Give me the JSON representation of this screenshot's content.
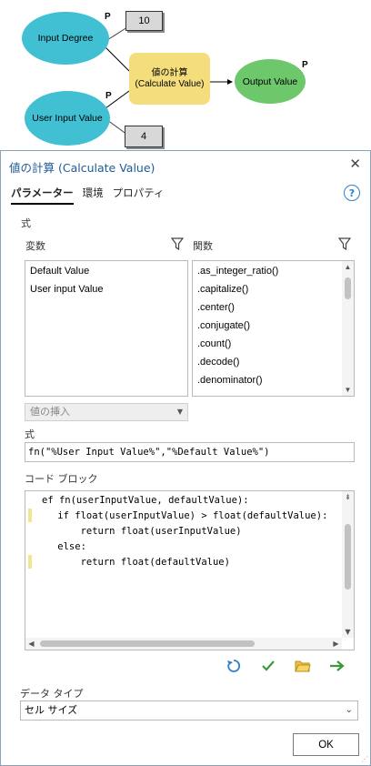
{
  "diagram": {
    "input_degree_label": "Input Degree",
    "input_degree_value": "10",
    "user_input_label": "User Input Value",
    "user_input_value": "4",
    "tool_label_jp": "値の計算",
    "tool_label_en": "(Calculate Value)",
    "output_label": "Output Value",
    "param_marker": "P",
    "colors": {
      "input": "#40c0d2",
      "tool": "#f4de7c",
      "output": "#6cc86a"
    }
  },
  "dialog": {
    "title": "値の計算 (Calculate Value)",
    "close_icon": "close-icon",
    "tabs": [
      {
        "label": "パラメーター",
        "active": true
      },
      {
        "label": "環境",
        "active": false
      },
      {
        "label": "プロパティ",
        "active": false
      }
    ],
    "help_glyph": "?",
    "expression_section_label": "式",
    "variables_label": "変数",
    "functions_label": "関数",
    "variables": [
      "Default Value",
      "User input Value"
    ],
    "functions": [
      ".as_integer_ratio()",
      ".capitalize()",
      ".center()",
      ".conjugate()",
      ".count()",
      ".decode()",
      ".denominator()"
    ],
    "insert_value_placeholder": "値の挿入",
    "expression_label": "式",
    "expression_value": "fn(\"%User Input Value%\",\"%Default Value%\")",
    "code_block_label": "コード ブロック",
    "code_lines": [
      "ef fn(userInputValue, defaultValue):",
      "    if float(userInputValue) > float(defaultValue):",
      "        return float(userInputValue)",
      "    else:",
      "        return float(defaultValue)"
    ],
    "data_type_label": "データ タイプ",
    "data_type_value": "セル サイズ",
    "ok_label": "OK",
    "colors": {
      "title": "#1e5a96",
      "accent": "#2f7fc8",
      "marker": "#f0e68c"
    }
  }
}
